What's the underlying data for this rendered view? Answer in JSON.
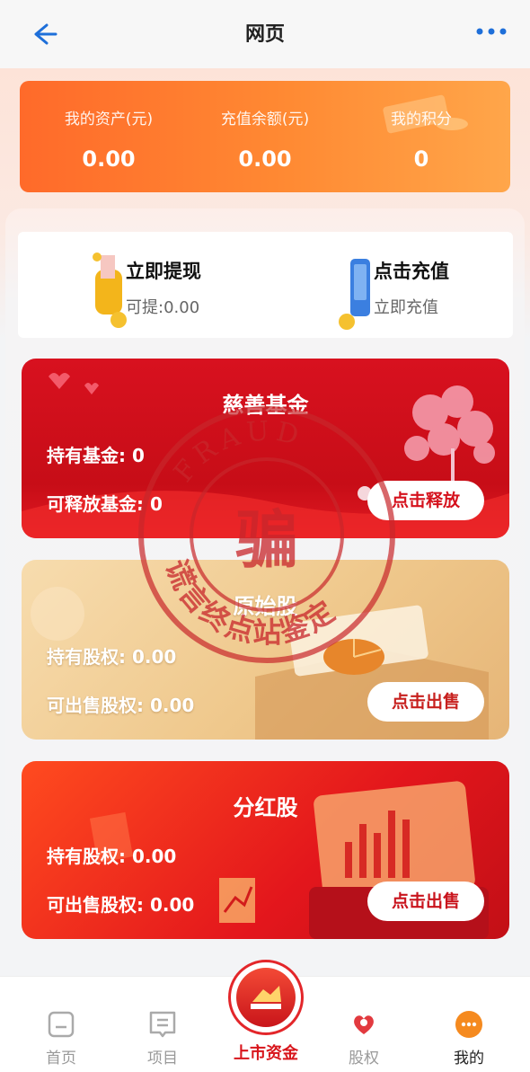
{
  "header": {
    "title": "网页"
  },
  "assets": [
    {
      "label": "我的资产(元)",
      "value": "0.00"
    },
    {
      "label": "充值余额(元)",
      "value": "0.00"
    },
    {
      "label": "我的积分",
      "value": "0"
    }
  ],
  "quick_actions": {
    "withdraw": {
      "title": "立即提现",
      "subtitle": "可提:0.00"
    },
    "recharge": {
      "title": "点击充值",
      "subtitle": "立即充值"
    }
  },
  "cards": {
    "charity": {
      "title": "慈善基金",
      "line1": "持有基金: 0",
      "line2": "可释放基金: 0",
      "button": "点击释放"
    },
    "original": {
      "title": "原始股",
      "line1": "持有股权: 0.00",
      "line2": "可出售股权: 0.00",
      "button": "点击出售"
    },
    "dividend": {
      "title": "分红股",
      "line1": "持有股权: 0.00",
      "line2": "可出售股权: 0.00",
      "button": "点击出售"
    }
  },
  "watermark": {
    "top_text": "FRAUD",
    "center": "骗",
    "bottom_text": "谎言终点站鉴定"
  },
  "tabbar": {
    "home": "首页",
    "projects": "项目",
    "listing": "上市资金",
    "equity": "股权",
    "mine": "我的"
  },
  "colors": {
    "accent": "#e3262a",
    "orange": "#ff7a2e",
    "link_blue": "#1e6fd9"
  }
}
